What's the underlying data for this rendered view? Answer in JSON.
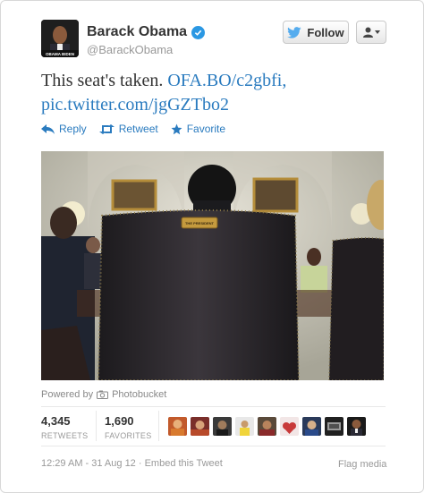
{
  "header": {
    "name": "Barack Obama",
    "handle": "@BarackObama",
    "follow_label": "Follow",
    "avatar_caption": "OBAMA BIDEN"
  },
  "tweet": {
    "text": "This seat's taken.",
    "link1": "OFA.BO/c2gbfi,",
    "link2": "pic.twitter.com/jgGZTbo2"
  },
  "actions": {
    "reply": "Reply",
    "retweet": "Retweet",
    "favorite": "Favorite"
  },
  "photo": {
    "plaque": "THE PRESIDENT"
  },
  "powered_by": {
    "prefix": "Powered by",
    "brand": "Photobucket"
  },
  "stats": {
    "retweets_count": "4,345",
    "retweets_label": "RETWEETS",
    "favorites_count": "1,690",
    "favorites_label": "FAVORITES"
  },
  "footer": {
    "timestamp": "12:29 AM - 31 Aug 12",
    "separator": " · ",
    "embed": "Embed this Tweet",
    "flag": "Flag media"
  },
  "colors": {
    "link": "#2a7bbf",
    "verified": "#2b98e3",
    "twitter_bird": "#55acee"
  }
}
